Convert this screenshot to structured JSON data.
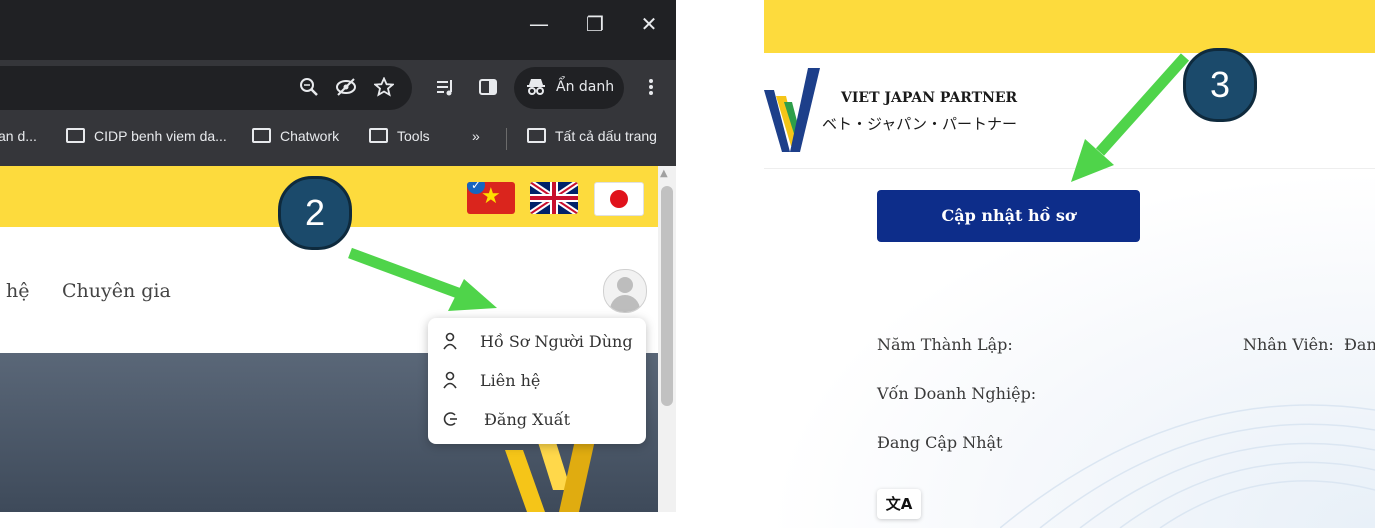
{
  "browser": {
    "window_controls": {
      "minimize": "—",
      "restore": "❐",
      "close": "✕"
    },
    "toolbar": {
      "incognito_label": "Ẩn danh"
    },
    "bookmarks": [
      {
        "label": "an d..."
      },
      {
        "label": "CIDP benh viem da..."
      },
      {
        "label": "Chatwork"
      },
      {
        "label": "Tools"
      },
      {
        "label": "»"
      },
      {
        "label": "Tất cả dấu trang"
      }
    ]
  },
  "site_left": {
    "languages": [
      "vi",
      "en",
      "ja"
    ],
    "nav": {
      "item_partial": "hệ",
      "item_expert": "Chuyên gia"
    },
    "user_menu": {
      "items": [
        {
          "label": "Hồ Sơ Người Dùng",
          "icon": "user-icon"
        },
        {
          "label": "Liên hệ",
          "icon": "user-icon"
        },
        {
          "label": "Đăng Xuất",
          "icon": "logout-icon"
        }
      ]
    }
  },
  "annotations": {
    "step2": "2",
    "step3": "3",
    "arrow_color": "#4fd44a"
  },
  "site_right": {
    "brand": {
      "name_en": "VIET JAPAN PARTNER",
      "name_ja": "ベト・ジャパン・パートナー"
    },
    "update_button": "Cập nhật hồ sơ",
    "fields": {
      "founded_label": "Năm Thành Lập:",
      "staff_label": "Nhân Viên:",
      "staff_value": "Đan",
      "capital_label": "Vốn Doanh Nghiệp:",
      "status_text": "Đang Cập Nhật"
    },
    "translate_icon_text": "文A"
  },
  "colors": {
    "accent_yellow": "#fddb3d",
    "button_blue": "#0d2d8a",
    "badge_blue": "#1b4a6b"
  }
}
